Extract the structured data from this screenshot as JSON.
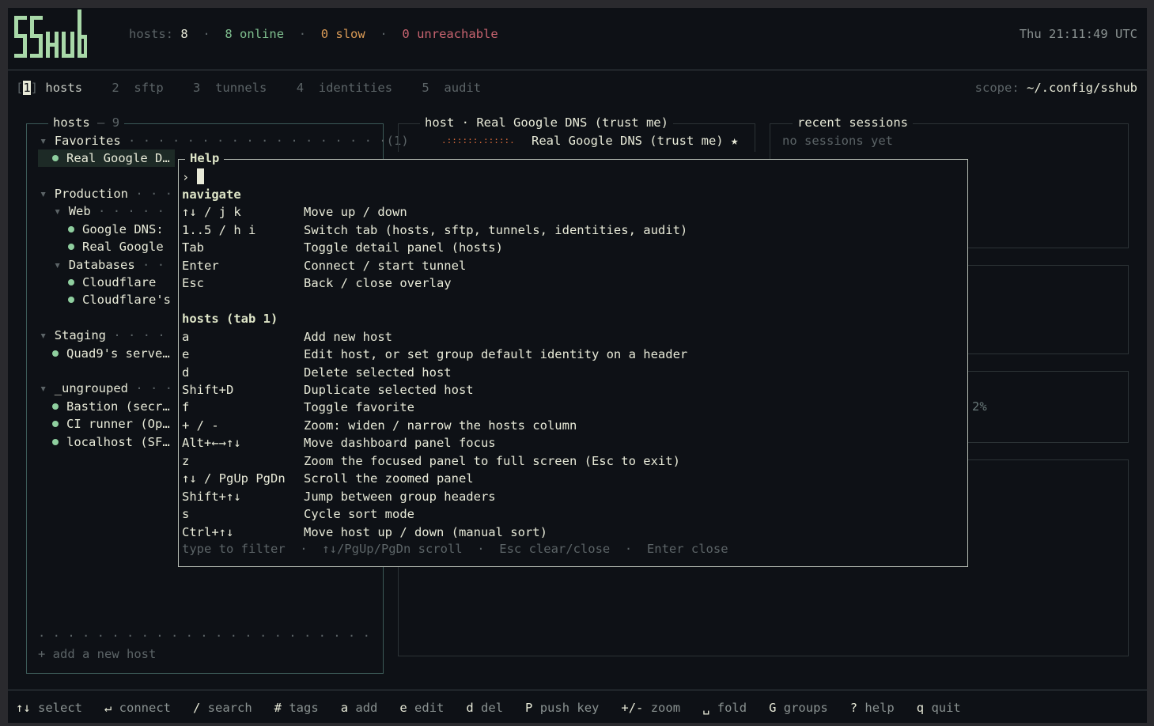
{
  "header": {
    "logo_text": "SSHUB",
    "stats": {
      "hosts_label": "hosts:",
      "hosts_count": "8",
      "online": "8 online",
      "slow": "0 slow",
      "unreachable": "0 unreachable",
      "sep": "·"
    },
    "clock": "Thu 21:11:49 UTC"
  },
  "tabs": [
    {
      "num": "1",
      "label": "hosts",
      "active": true
    },
    {
      "num": "2",
      "label": "sftp"
    },
    {
      "num": "3",
      "label": "tunnels"
    },
    {
      "num": "4",
      "label": "identities"
    },
    {
      "num": "5",
      "label": "audit"
    }
  ],
  "scope": {
    "label": "scope:",
    "value": "~/.config/sshub"
  },
  "hosts_panel": {
    "title": "hosts",
    "count": "9",
    "favorites": {
      "label": "Favorites",
      "count": "(1)",
      "items": [
        "Real Google D…"
      ]
    },
    "production": {
      "label": "Production"
    },
    "web": {
      "label": "Web",
      "items": [
        "Google DNS:",
        "Real Google"
      ]
    },
    "databases": {
      "label": "Databases",
      "items": [
        "Cloudflare",
        "Cloudflare's"
      ]
    },
    "staging": {
      "label": "Staging",
      "items": [
        "Quad9's serve…"
      ]
    },
    "ungrouped": {
      "label": "_ungrouped",
      "items": [
        "Bastion (secr…",
        "CI runner (Op…",
        "localhost (SF…"
      ]
    },
    "add_host": "+ add a new host"
  },
  "host_panel": {
    "title": "host · Real Google DNS (trust me)",
    "name": "Real Google DNS (trust me) ★",
    "spark": ".::::::.:::::."
  },
  "sessions_panel": {
    "title": "recent sessions",
    "empty": "no sessions yet"
  },
  "partial_value": "2%",
  "help": {
    "title": "Help",
    "prompt": "›",
    "sections": [
      {
        "heading": "navigate",
        "rows": [
          {
            "key": "↑↓ / j k",
            "desc": "Move up / down"
          },
          {
            "key": "1..5 / h i",
            "desc": "Switch tab (hosts, sftp, tunnels, identities, audit)"
          },
          {
            "key": "Tab",
            "desc": "Toggle detail panel (hosts)"
          },
          {
            "key": "Enter",
            "desc": "Connect / start tunnel"
          },
          {
            "key": "Esc",
            "desc": "Back / close overlay"
          }
        ]
      },
      {
        "heading": "hosts (tab 1)",
        "rows": [
          {
            "key": "a",
            "desc": "Add new host"
          },
          {
            "key": "e",
            "desc": "Edit host, or set group default identity on a header"
          },
          {
            "key": "d",
            "desc": "Delete selected host"
          },
          {
            "key": "Shift+D",
            "desc": "Duplicate selected host"
          },
          {
            "key": "f",
            "desc": "Toggle favorite"
          },
          {
            "key": "+ / -",
            "desc": "Zoom: widen / narrow the hosts column"
          },
          {
            "key": "Alt+←→↑↓",
            "desc": "Move dashboard panel focus"
          },
          {
            "key": "z",
            "desc": "Zoom the focused panel to full screen (Esc to exit)"
          },
          {
            "key": "↑↓ / PgUp PgDn",
            "desc": "Scroll the zoomed panel"
          },
          {
            "key": "Shift+↑↓",
            "desc": "Jump between group headers"
          },
          {
            "key": "s",
            "desc": "Cycle sort mode"
          },
          {
            "key": "Ctrl+↑↓",
            "desc": "Move host up / down (manual sort)"
          }
        ]
      }
    ],
    "hint": "type to filter  ·  ↑↓/PgUp/PgDn scroll  ·  Esc clear/close  ·  Enter close"
  },
  "footer": [
    {
      "key": "↑↓",
      "label": "select"
    },
    {
      "key": "↵",
      "label": "connect"
    },
    {
      "key": "/",
      "label": "search"
    },
    {
      "key": "#",
      "label": "tags"
    },
    {
      "key": "a",
      "label": "add"
    },
    {
      "key": "e",
      "label": "edit"
    },
    {
      "key": "d",
      "label": "del"
    },
    {
      "key": "P",
      "label": "push key"
    },
    {
      "key": "+/-",
      "label": "zoom"
    },
    {
      "key": "␣",
      "label": "fold"
    },
    {
      "key": "G",
      "label": "groups"
    },
    {
      "key": "?",
      "label": "help"
    },
    {
      "key": "q",
      "label": "quit"
    }
  ]
}
